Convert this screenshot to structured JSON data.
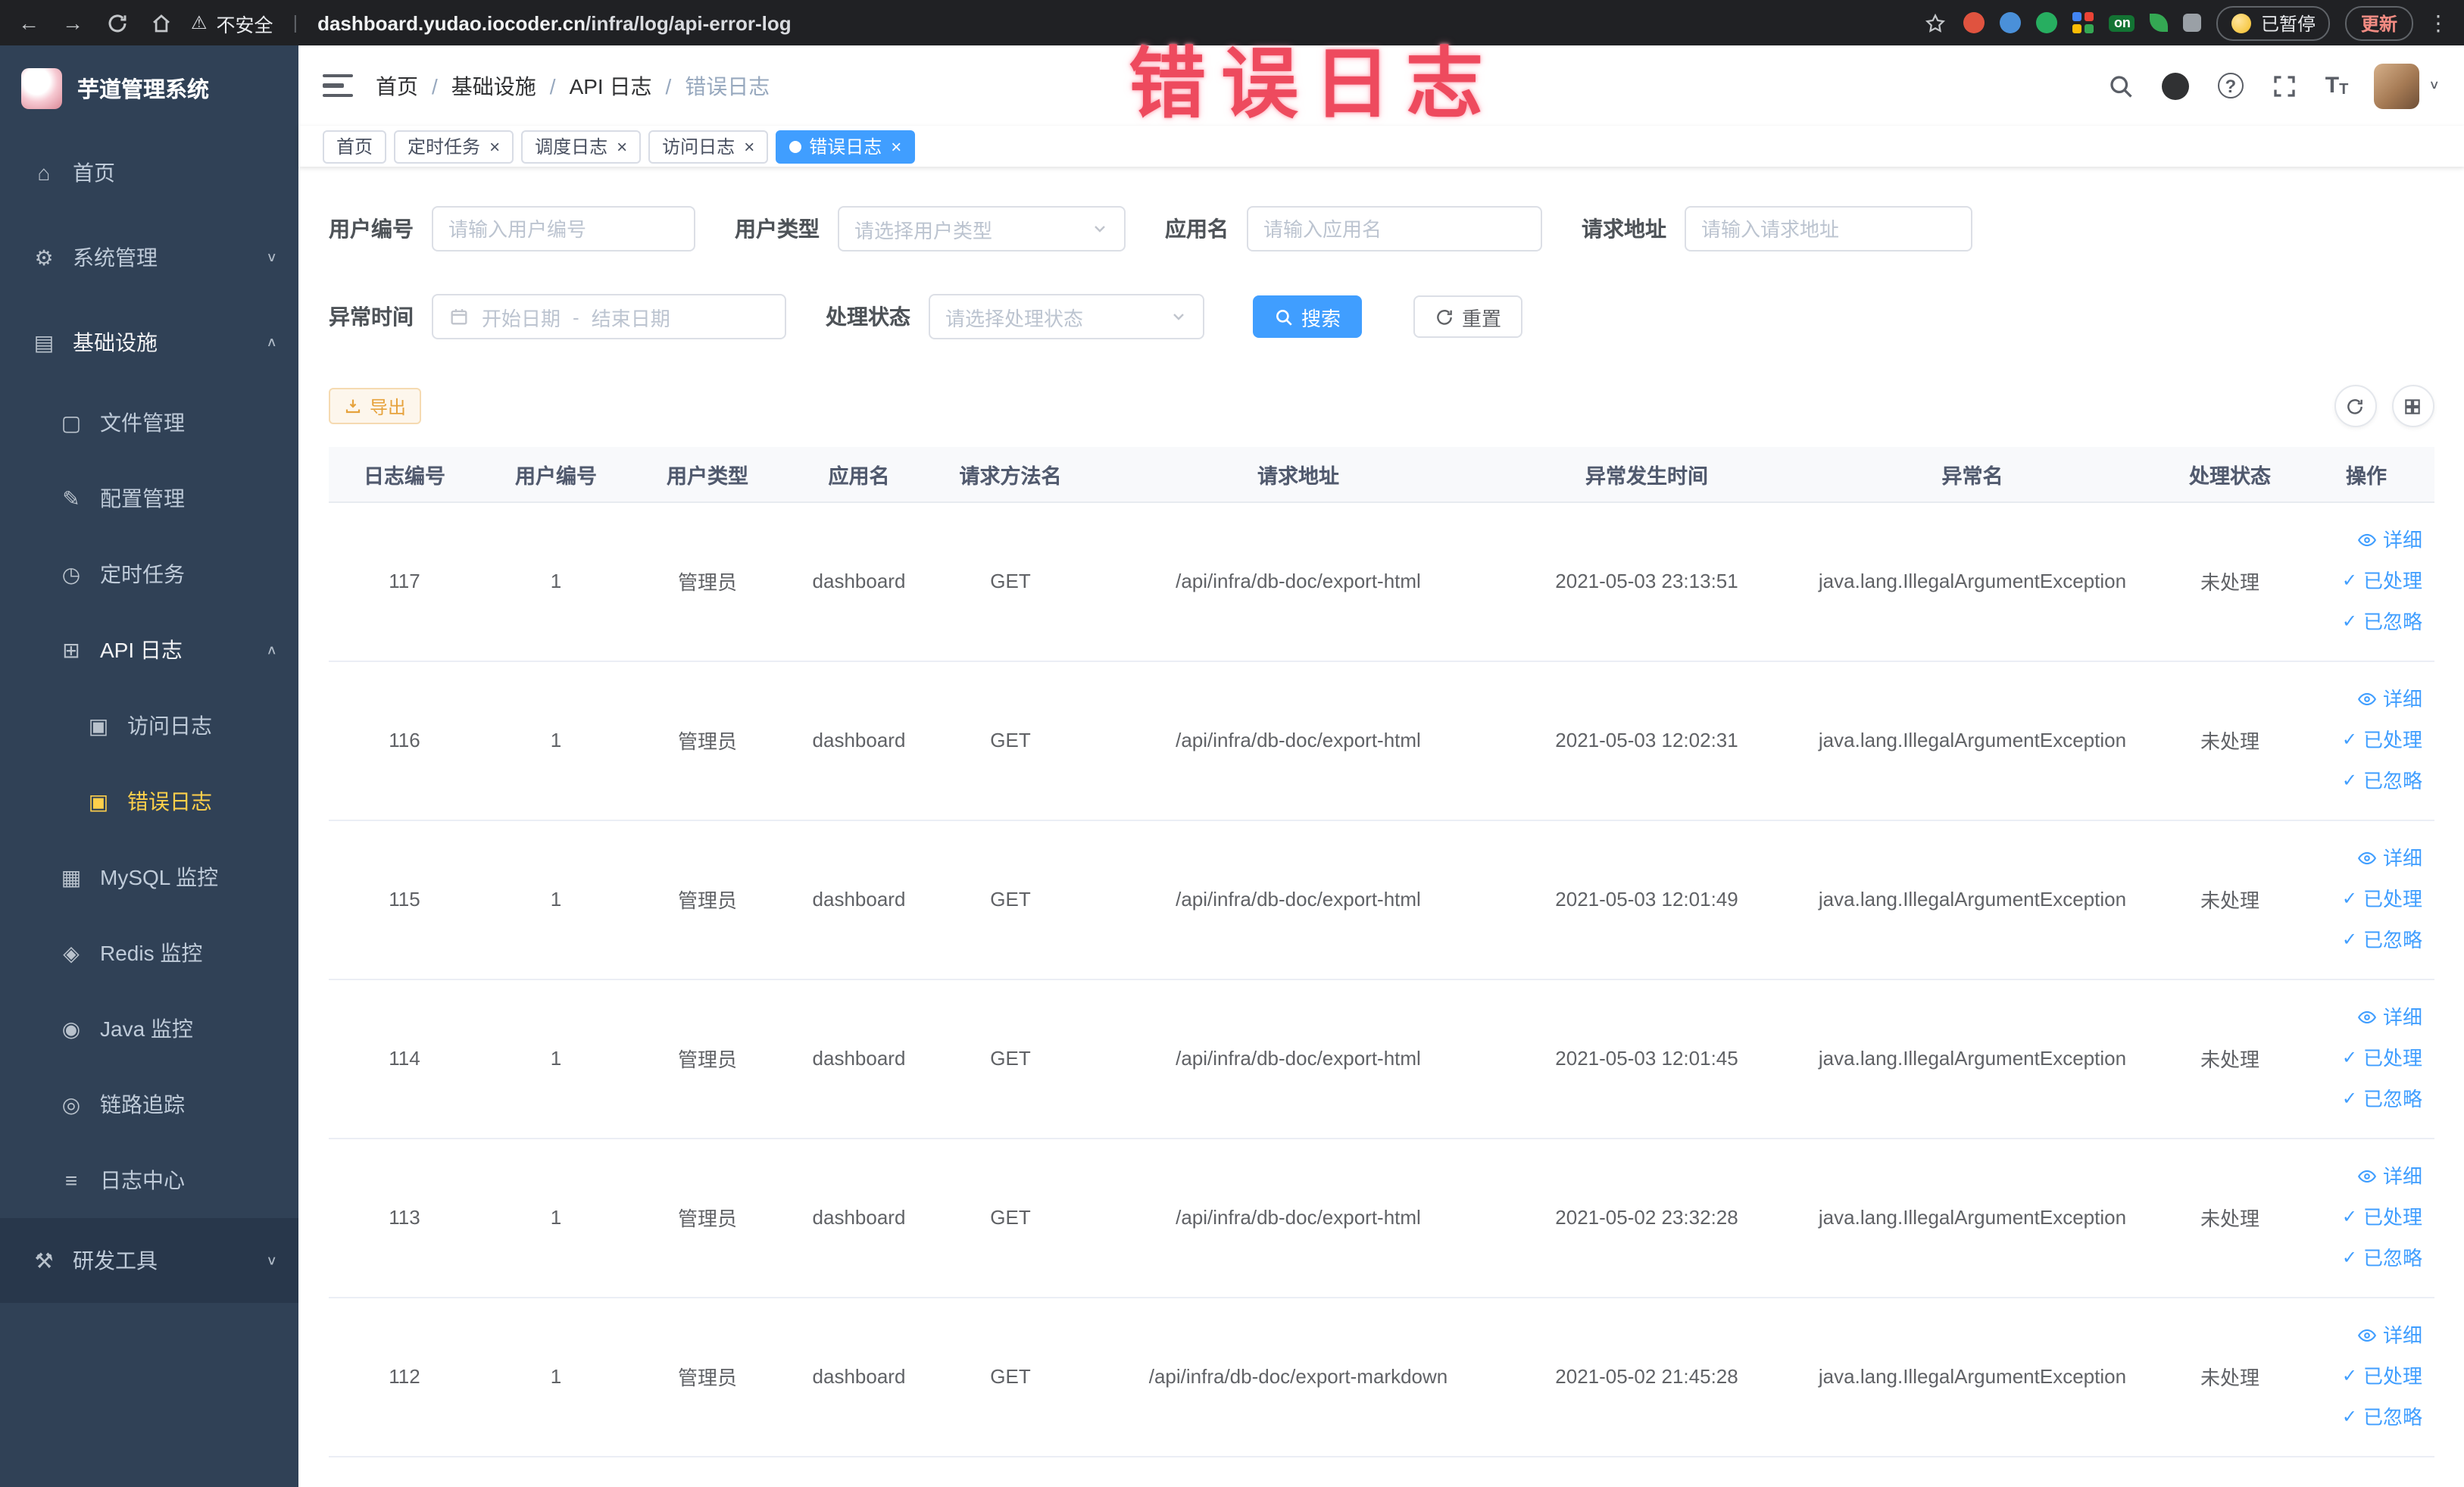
{
  "accent_color": "#409eff",
  "sidebar_bg_color": "#304156",
  "active_menu_color": "#ffd04b",
  "browser": {
    "security_label": "不安全",
    "url_host": "dashboard.yudao.iocoder.cn",
    "url_path": "/infra/log/api-error-log",
    "on_badge": "on",
    "paused_badge": "已暂停",
    "update_button": "更新"
  },
  "sidebar": {
    "logo_title": "芋道管理系统",
    "items": [
      {
        "key": "home",
        "label": "首页",
        "icon": "home-icon",
        "level": 1
      },
      {
        "key": "system",
        "label": "系统管理",
        "icon": "gear-icon",
        "level": 1,
        "chevron": "down"
      },
      {
        "key": "infra",
        "label": "基础设施",
        "icon": "infra-icon",
        "level": 1,
        "chevron": "up",
        "open": true
      },
      {
        "key": "file",
        "label": "文件管理",
        "icon": "file-icon",
        "level": 2
      },
      {
        "key": "config",
        "label": "配置管理",
        "icon": "config-icon",
        "level": 2
      },
      {
        "key": "job",
        "label": "定时任务",
        "icon": "timer-icon",
        "level": 2
      },
      {
        "key": "api-log",
        "label": "API 日志",
        "icon": "api-log-icon",
        "level": 2,
        "chevron": "up",
        "open": true
      },
      {
        "key": "access-log",
        "label": "访问日志",
        "icon": "doc-icon",
        "level": 3
      },
      {
        "key": "error-log",
        "label": "错误日志",
        "icon": "doc-icon",
        "level": 3,
        "active": true
      },
      {
        "key": "mysql",
        "label": "MySQL 监控",
        "icon": "mysql-icon",
        "level": 2
      },
      {
        "key": "redis",
        "label": "Redis 监控",
        "icon": "redis-icon",
        "level": 2
      },
      {
        "key": "java",
        "label": "Java 监控",
        "icon": "java-icon",
        "level": 2
      },
      {
        "key": "trace",
        "label": "链路追踪",
        "icon": "trace-icon",
        "level": 2
      },
      {
        "key": "log-center",
        "label": "日志中心",
        "icon": "log-center-icon",
        "level": 2
      },
      {
        "key": "devtools",
        "label": "研发工具",
        "icon": "tools-icon",
        "level": 1,
        "chevron": "down",
        "dark": true
      }
    ]
  },
  "header": {
    "breadcrumb": [
      "首页",
      "基础设施",
      "API 日志",
      "错误日志"
    ],
    "overlay_annotation": "错误日志"
  },
  "tabs": [
    {
      "label": "首页",
      "closable": false,
      "active": false
    },
    {
      "label": "定时任务",
      "closable": true,
      "active": false
    },
    {
      "label": "调度日志",
      "closable": true,
      "active": false
    },
    {
      "label": "访问日志",
      "closable": true,
      "active": false
    },
    {
      "label": "错误日志",
      "closable": true,
      "active": true
    }
  ],
  "filters": {
    "user_id": {
      "label": "用户编号",
      "placeholder": "请输入用户编号"
    },
    "user_type": {
      "label": "用户类型",
      "placeholder": "请选择用户类型"
    },
    "app_name": {
      "label": "应用名",
      "placeholder": "请输入应用名"
    },
    "request_url": {
      "label": "请求地址",
      "placeholder": "请输入请求地址"
    },
    "exception_time": {
      "label": "异常时间",
      "start_placeholder": "开始日期",
      "separator": "-",
      "end_placeholder": "结束日期"
    },
    "process_status": {
      "label": "处理状态",
      "placeholder": "请选择处理状态"
    },
    "search_label": "搜索",
    "reset_label": "重置"
  },
  "toolbar": {
    "export_label": "导出"
  },
  "table": {
    "columns": [
      "日志编号",
      "用户编号",
      "用户类型",
      "应用名",
      "请求方法名",
      "请求地址",
      "异常发生时间",
      "异常名",
      "处理状态",
      "操作"
    ],
    "action_labels": {
      "detail": "详细",
      "processed": "已处理",
      "ignored": "已忽略"
    },
    "rows": [
      {
        "id": "117",
        "user_id": "1",
        "user_type": "管理员",
        "app": "dashboard",
        "method": "GET",
        "url": "/api/infra/db-doc/export-html",
        "time": "2021-05-03 23:13:51",
        "exception": "java.lang.IllegalArgumentException",
        "status": "未处理"
      },
      {
        "id": "116",
        "user_id": "1",
        "user_type": "管理员",
        "app": "dashboard",
        "method": "GET",
        "url": "/api/infra/db-doc/export-html",
        "time": "2021-05-03 12:02:31",
        "exception": "java.lang.IllegalArgumentException",
        "status": "未处理"
      },
      {
        "id": "115",
        "user_id": "1",
        "user_type": "管理员",
        "app": "dashboard",
        "method": "GET",
        "url": "/api/infra/db-doc/export-html",
        "time": "2021-05-03 12:01:49",
        "exception": "java.lang.IllegalArgumentException",
        "status": "未处理"
      },
      {
        "id": "114",
        "user_id": "1",
        "user_type": "管理员",
        "app": "dashboard",
        "method": "GET",
        "url": "/api/infra/db-doc/export-html",
        "time": "2021-05-03 12:01:45",
        "exception": "java.lang.IllegalArgumentException",
        "status": "未处理"
      },
      {
        "id": "113",
        "user_id": "1",
        "user_type": "管理员",
        "app": "dashboard",
        "method": "GET",
        "url": "/api/infra/db-doc/export-html",
        "time": "2021-05-02 23:32:28",
        "exception": "java.lang.IllegalArgumentException",
        "status": "未处理"
      },
      {
        "id": "112",
        "user_id": "1",
        "user_type": "管理员",
        "app": "dashboard",
        "method": "GET",
        "url": "/api/infra/db-doc/export-markdown",
        "time": "2021-05-02 21:45:28",
        "exception": "java.lang.IllegalArgumentException",
        "status": "未处理"
      }
    ]
  }
}
